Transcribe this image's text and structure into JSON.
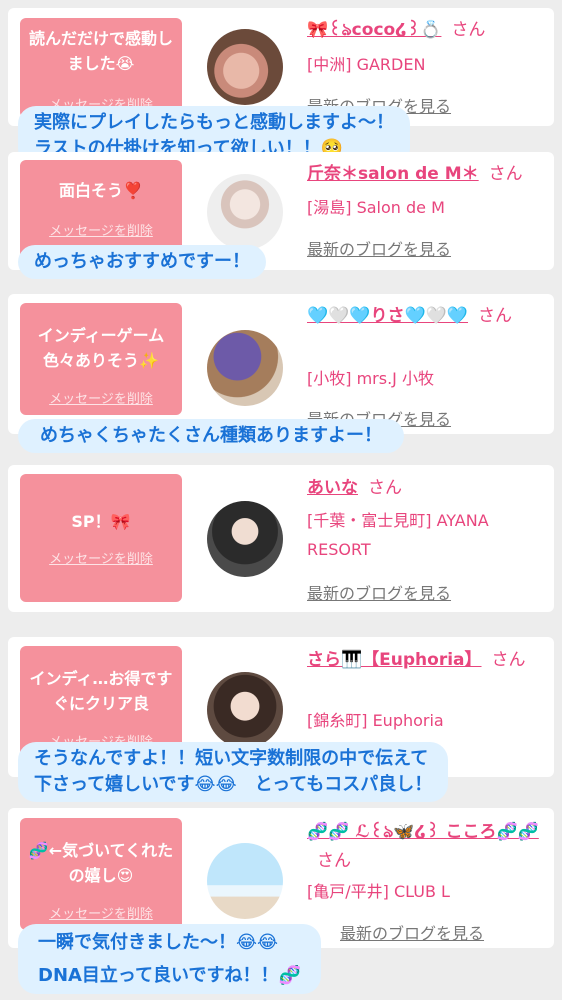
{
  "cards": [
    {
      "message": "読んだだけで感動しました😭",
      "delete_label": "メッセージを削除",
      "name": "🎀꒰ঌcoco໒꒱💍",
      "san": "さん",
      "shop": "[中洲] GARDEN",
      "blog": "最新のブログを見る",
      "reply": "実際にプレイしたらもっと感動しますよ〜！\nラストの仕掛けを知って欲しい！！🥺"
    },
    {
      "message": "面白そう❣️",
      "delete_label": "メッセージを削除",
      "name": "斤奈＊salon de M＊",
      "san": "さん",
      "shop": "[湯島] Salon de M",
      "blog": "最新のブログを見る",
      "reply": "めっちゃおすすめですー！"
    },
    {
      "message": "インディーゲーム色々ありそう✨",
      "delete_label": "メッセージを削除",
      "name": "🩵🤍🩵りさ🩵🤍🩵",
      "san": "さん",
      "shop": "[小牧] mrs.J 小牧",
      "blog": "最新のブログを見る",
      "reply": "めちゃくちゃたくさん種類ありますよー！"
    },
    {
      "message": "SP！🎀",
      "delete_label": "メッセージを削除",
      "name": "あいな",
      "san": "さん",
      "shop": "[千葉・富士見町] AYANA RESORT",
      "blog": "最新のブログを見る",
      "reply": ""
    },
    {
      "message": "インディ…お得ですぐにクリア良",
      "delete_label": "メッセージを削除",
      "name": "さら🎹【Euphoria】",
      "san": "さん",
      "shop": "[錦糸町] Euphoria",
      "blog": "最新のブログを見る",
      "reply": "そうなんですよ！！短い文字数制限の中で伝えて\n下さって嬉しいです😂😂　とってもコスパ良し！"
    },
    {
      "message": "🧬←気づいてくれたの嬉し😍",
      "delete_label": "メッセージを削除",
      "name": "🧬🧬 ℒ꒰ঌ🦋໒꒱ こころ🧬🧬",
      "san": "さん",
      "shop": "[亀戸/平井] CLUB L",
      "blog": "最新のブログを見る",
      "reply": "一瞬で気付きました〜！😂😂\nDNA目立って良いですね！！🧬"
    }
  ],
  "colors": {
    "accent": "#e8457d",
    "message_bg": "#f5919c",
    "bubble_bg": "#dff1ff",
    "bubble_text": "#1a72d6"
  }
}
